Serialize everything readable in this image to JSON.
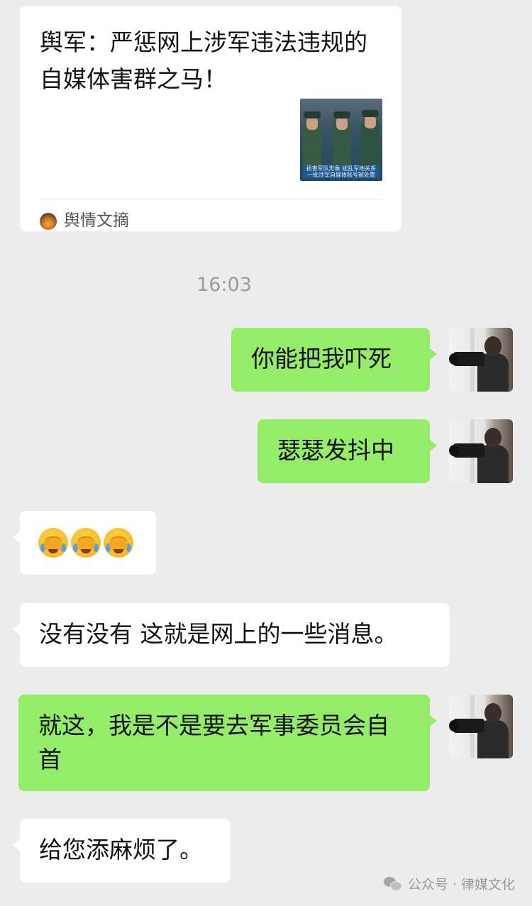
{
  "shared_card": {
    "title": "舆军：严惩网上涉军违法违规的自媒体害群之马！",
    "thumbnail_caption": "损害军队形象 扰乱军地关系 一批涉军自媒体账号被处置",
    "source_name": "舆情文摘",
    "source_icon": "sunset-logo-icon"
  },
  "timestamp": "16:03",
  "messages": [
    {
      "side": "right",
      "text": "你能把我吓死"
    },
    {
      "side": "right",
      "text": "瑟瑟发抖中"
    },
    {
      "side": "left",
      "emoji": [
        "facepalm-crying-emoji",
        "facepalm-crying-emoji",
        "facepalm-crying-emoji"
      ]
    },
    {
      "side": "left",
      "text": "没有没有 这就是网上的一些消息。"
    },
    {
      "side": "right",
      "text": "就这，我是不是要去军事委员会自首"
    },
    {
      "side": "left",
      "text": "给您添麻烦了。"
    }
  ],
  "watermark": {
    "text": "公众号 · 律媒文化",
    "icon": "wechat-icon"
  },
  "colors": {
    "background": "#ececec",
    "incoming_bubble": "#ffffff",
    "outgoing_bubble": "#95ec69",
    "timestamp_text": "#9b9b9b"
  }
}
